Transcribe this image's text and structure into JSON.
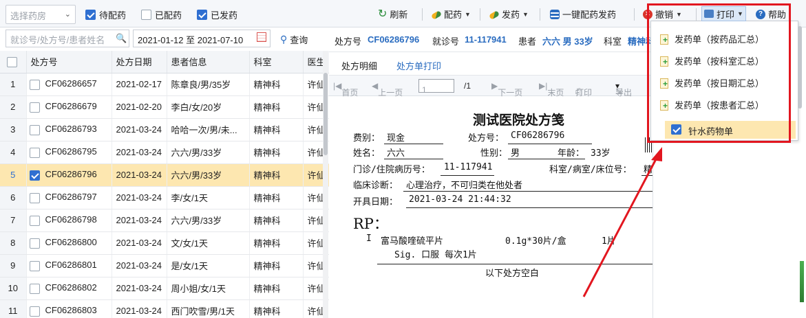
{
  "toolbar": {
    "pharmacy_select_placeholder": "选择药房",
    "filters": [
      {
        "label": "待配药",
        "checked": true
      },
      {
        "label": "已配药",
        "checked": false
      },
      {
        "label": "已发药",
        "checked": true
      }
    ],
    "refresh_label": "刷新",
    "dispense_label": "配药",
    "issue_label": "发药",
    "one_click_label": "一键配药发药",
    "undo_label": "撤销",
    "print_label": "打印",
    "help_label": "帮助"
  },
  "search": {
    "placeholder": "就诊号/处方号/患者姓名",
    "date_range": "2021-01-12 至 2021-07-10",
    "query_label": "查询"
  },
  "grid": {
    "columns": [
      "处方号",
      "处方日期",
      "患者信息",
      "科室",
      "医生"
    ],
    "rows": [
      {
        "n": "1",
        "no": "CF06286657",
        "date": "2021-02-17",
        "patient": "陈章良/男/35岁",
        "dept": "精神科",
        "doc": "许仙"
      },
      {
        "n": "2",
        "no": "CF06286679",
        "date": "2021-02-20",
        "patient": "李白/女/20岁",
        "dept": "精神科",
        "doc": "许仙"
      },
      {
        "n": "3",
        "no": "CF06286793",
        "date": "2021-03-24",
        "patient": "哈哈一次/男/未...",
        "dept": "精神科",
        "doc": "许仙"
      },
      {
        "n": "4",
        "no": "CF06286795",
        "date": "2021-03-24",
        "patient": "六六/男/33岁",
        "dept": "精神科",
        "doc": "许仙"
      },
      {
        "n": "5",
        "no": "CF06286796",
        "date": "2021-03-24",
        "patient": "六六/男/33岁",
        "dept": "精神科",
        "doc": "许仙",
        "selected": true
      },
      {
        "n": "6",
        "no": "CF06286797",
        "date": "2021-03-24",
        "patient": "李/女/1天",
        "dept": "精神科",
        "doc": "许仙"
      },
      {
        "n": "7",
        "no": "CF06286798",
        "date": "2021-03-24",
        "patient": "六六/男/33岁",
        "dept": "精神科",
        "doc": "许仙"
      },
      {
        "n": "8",
        "no": "CF06286800",
        "date": "2021-03-24",
        "patient": "文/女/1天",
        "dept": "精神科",
        "doc": "许仙"
      },
      {
        "n": "9",
        "no": "CF06286801",
        "date": "2021-03-24",
        "patient": "是/女/1天",
        "dept": "精神科",
        "doc": "许仙"
      },
      {
        "n": "10",
        "no": "CF06286802",
        "date": "2021-03-24",
        "patient": "周小姐/女/1天",
        "dept": "精神科",
        "doc": "许仙"
      },
      {
        "n": "11",
        "no": "CF06286803",
        "date": "2021-03-24",
        "patient": "西门吹雪/男/1天",
        "dept": "精神科",
        "doc": "许仙"
      }
    ]
  },
  "detail_header": {
    "rx_label": "处方号",
    "rx_value": "CF06286796",
    "visit_label": "就诊号",
    "visit_value": "11-117941",
    "patient_label": "患者",
    "patient_value": "六六 男 33岁",
    "dept_label": "科室",
    "dept_value": "精神科"
  },
  "tabs": [
    "处方明细",
    "处方单打印"
  ],
  "pager": {
    "first": "首页",
    "prev": "上一页",
    "page": "1",
    "total": "/1",
    "next": "下一页",
    "last": "末页",
    "print": "打印",
    "export": "导出"
  },
  "prescription": {
    "hospital_title": "测试医院处方笺",
    "fee_type_label": "费别：",
    "fee_type_value": "现金",
    "rx_no_label": "处方号：",
    "rx_no_value": "CF06286796",
    "name_label": "姓名：",
    "name_value": "六六",
    "sex_label": "性别：",
    "sex_value": "男",
    "age_label": "年龄：",
    "age_value": "33岁",
    "record_label": "门诊/住院病历号：",
    "record_value": "11-117941",
    "ward_label": "科室/病室/床位号：",
    "ward_value": "精",
    "diagnosis_label": "临床诊断：",
    "diagnosis_value": "心理治疗，不可归类在他处者",
    "issue_date_label": "开具日期：",
    "issue_date_value": "2021-03-24 21:44:32",
    "rp": "RP：",
    "item_index": "I",
    "item_name": "富马酸喹硫平片",
    "item_spec": "0.1g*30片/盒",
    "item_qty": "1片",
    "item_usage": "Sig. 口服 每次1片",
    "footer": "以下处方空白"
  },
  "print_menu": {
    "items": [
      "发药单（按药品汇总）",
      "发药单（按科室汇总）",
      "发药单（按日期汇总）",
      "发药单（按患者汇总）"
    ],
    "extra_item": "针水药物单"
  },
  "colors": {
    "highlight": "#fde7b0",
    "accent": "#2a6cc0",
    "annotation": "#e2161f"
  }
}
